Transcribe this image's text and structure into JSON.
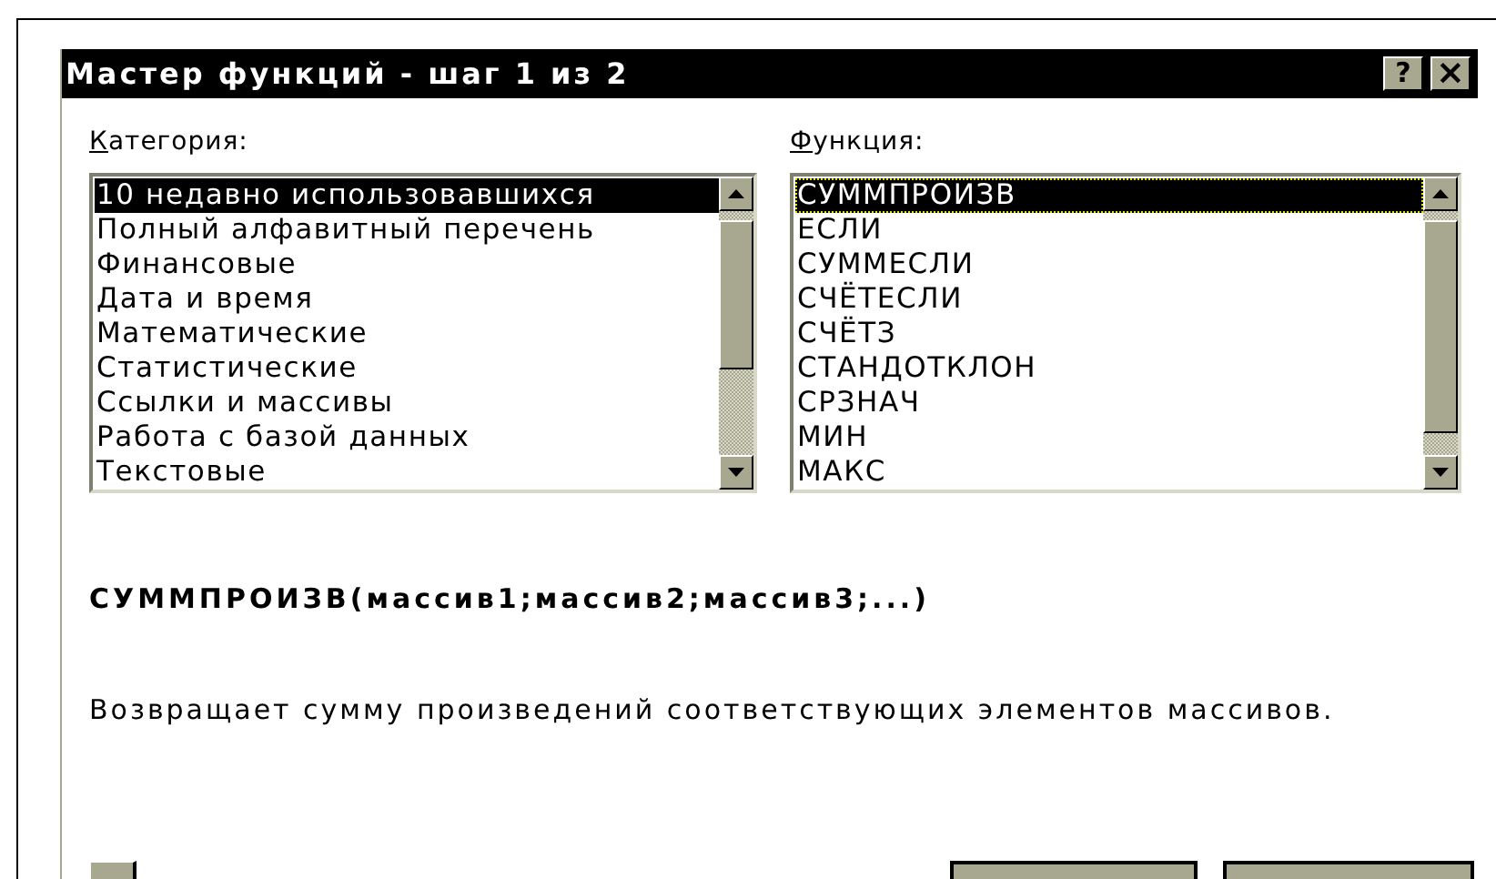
{
  "window": {
    "title": "Мастер функций - шаг 1 из 2",
    "title_buttons": [
      {
        "kind": "help",
        "label": "?"
      },
      {
        "kind": "close",
        "label": "×"
      }
    ]
  },
  "category": {
    "label": "Категория:",
    "items": [
      {
        "label": "10 недавно использовавшихся",
        "selected": true
      },
      {
        "label": "Полный алфавитный перечень",
        "selected": false
      },
      {
        "label": "Финансовые",
        "selected": false
      },
      {
        "label": "Дата и время",
        "selected": false
      },
      {
        "label": "Математические",
        "selected": false
      },
      {
        "label": "Статистические",
        "selected": false
      },
      {
        "label": "Ссылки и массивы",
        "selected": false
      },
      {
        "label": "Работа с базой данных",
        "selected": false
      },
      {
        "label": "Текстовые",
        "selected": false
      }
    ]
  },
  "function": {
    "label": "Функция:",
    "items": [
      {
        "label": "СУММПРОИЗВ",
        "selected": true
      },
      {
        "label": "ЕСЛИ",
        "selected": false
      },
      {
        "label": "СУММЕСЛИ",
        "selected": false
      },
      {
        "label": "СЧЁТЕСЛИ",
        "selected": false
      },
      {
        "label": "СЧЁТЗ",
        "selected": false
      },
      {
        "label": "СТАНДОТКЛОН",
        "selected": false
      },
      {
        "label": "СРЗНАЧ",
        "selected": false
      },
      {
        "label": "МИН",
        "selected": false
      },
      {
        "label": "МАКС",
        "selected": false
      }
    ]
  },
  "syntax": "СУММПРОИЗВ(массив1;массив2;массив3;...)",
  "description": "Возвращает сумму произведений соответствующих элементов массивов."
}
